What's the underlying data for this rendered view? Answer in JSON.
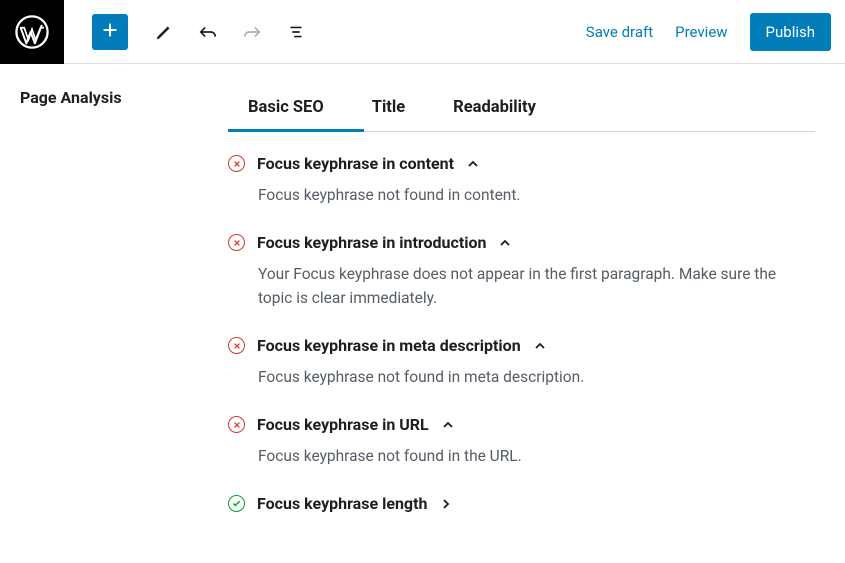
{
  "topbar": {
    "save_draft": "Save draft",
    "preview": "Preview",
    "publish": "Publish"
  },
  "sidebar": {
    "title": "Page Analysis"
  },
  "tabs": [
    {
      "label": "Basic SEO",
      "active": true
    },
    {
      "label": "Title",
      "active": false
    },
    {
      "label": "Readability",
      "active": false
    }
  ],
  "items": [
    {
      "status": "error",
      "title": "Focus keyphrase in content",
      "expanded": true,
      "desc": "Focus keyphrase not found in content."
    },
    {
      "status": "error",
      "title": "Focus keyphrase in introduction",
      "expanded": true,
      "desc": "Your Focus keyphrase does not appear in the first paragraph. Make sure the topic is clear immediately."
    },
    {
      "status": "error",
      "title": "Focus keyphrase in meta description",
      "expanded": true,
      "desc": "Focus keyphrase not found in meta description."
    },
    {
      "status": "error",
      "title": "Focus keyphrase in URL",
      "expanded": true,
      "desc": "Focus keyphrase not found in the URL."
    },
    {
      "status": "ok",
      "title": "Focus keyphrase length",
      "expanded": false,
      "desc": ""
    }
  ]
}
